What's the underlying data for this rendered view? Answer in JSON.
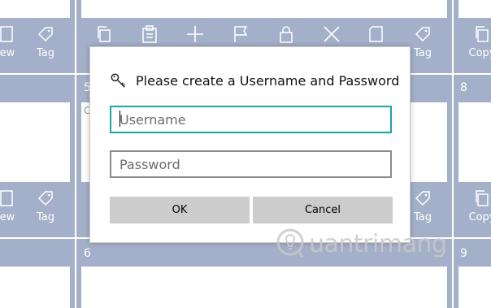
{
  "dialog": {
    "title": "Please create a Username and Password",
    "username_placeholder": "Username",
    "password_placeholder": "Password",
    "ok_label": "OK",
    "cancel_label": "Cancel",
    "icon": "key-icon",
    "accent_color": "#1aa3ad"
  },
  "background": {
    "tile_color": "#a4b0c9",
    "toolbar_top": [
      {
        "name": "view",
        "label": "ew",
        "icon": "view-icon"
      },
      {
        "name": "tag",
        "label": "Tag",
        "icon": "tag-icon"
      },
      {
        "name": "copy",
        "icon": "copy-icon"
      },
      {
        "name": "paste",
        "icon": "paste-icon"
      },
      {
        "name": "add",
        "icon": "plus-icon"
      },
      {
        "name": "flag",
        "icon": "flag-icon"
      },
      {
        "name": "lock",
        "icon": "lock-icon"
      },
      {
        "name": "close",
        "icon": "close-icon"
      },
      {
        "name": "blank",
        "icon": "page-icon"
      },
      {
        "name": "tag-right",
        "label": "Tag",
        "icon": "tag-icon"
      },
      {
        "name": "copy-right",
        "label": "Copy",
        "icon": "copy-icon"
      }
    ],
    "toolbar_bottom": [
      {
        "name": "view",
        "label": "ew"
      },
      {
        "name": "tag",
        "label": "Tag"
      },
      {
        "name": "tag-right",
        "label": "Tag"
      },
      {
        "name": "copy-right",
        "label": "Copy"
      }
    ],
    "tile_numbers": [
      "5",
      "8",
      "6",
      "9"
    ],
    "tile_stub_text": "C"
  },
  "watermark": {
    "text": "uantrimang",
    "icon": "lightbulb-icon"
  }
}
